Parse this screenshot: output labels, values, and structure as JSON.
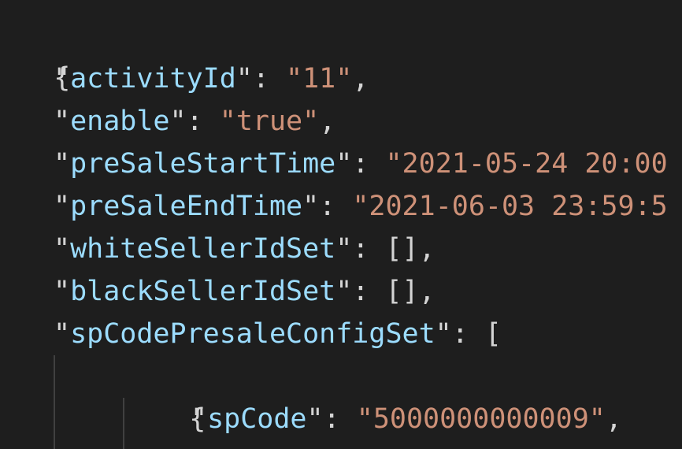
{
  "editor": {
    "open_brace": "{",
    "lines": [
      {
        "key": "activityId",
        "value": "11",
        "kind": "string"
      },
      {
        "key": "enable",
        "value": "true",
        "kind": "string"
      },
      {
        "key": "preSaleStartTime",
        "value": "2021-05-24 20:00",
        "kind": "string"
      },
      {
        "key": "preSaleEndTime",
        "value": "2021-06-03 23:59:5",
        "kind": "string"
      },
      {
        "key": "whiteSellerIdSet",
        "value": "[],",
        "kind": "raw"
      },
      {
        "key": "blackSellerIdSet",
        "value": "[],",
        "kind": "raw"
      },
      {
        "key": "spCodePresaleConfigSet",
        "value": "[",
        "kind": "raw"
      }
    ],
    "inner_open_brace": "{",
    "nested_line": {
      "key": "spCode",
      "value": "5000000000009"
    }
  },
  "colors": {
    "background": "#1e1e1e",
    "key": "#9cdcfe",
    "string": "#ce9178",
    "punctuation": "#d4d4d4",
    "indent_guide": "#404040"
  }
}
